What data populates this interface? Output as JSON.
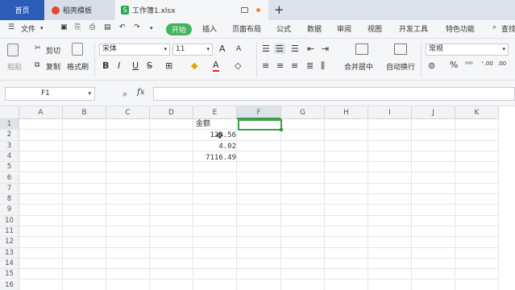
{
  "tabs": {
    "home": "首页",
    "template": "稻壳模板",
    "file": "工作簿1.xlsx"
  },
  "menu": {
    "file": "文件",
    "start": "开始",
    "insert": "插入",
    "layout": "页面布局",
    "formula": "公式",
    "data": "数据",
    "review": "审阅",
    "view": "视图",
    "dev": "开发工具",
    "special": "特色功能",
    "search": "查找"
  },
  "toolbar": {
    "paste": "粘贴",
    "cut": "剪切",
    "copy": "复制",
    "format_painter": "格式刷",
    "font": "宋体",
    "size": "11",
    "merge": "合并居中",
    "wrap": "自动换行",
    "numfmt": "常规",
    "bold": "B",
    "italic": "I",
    "underline": "U",
    "font_grow": "A",
    "font_shrink": "A",
    "font_color": "A",
    "percent": "%"
  },
  "formula_bar": {
    "cell_ref": "F1",
    "fx": "fx",
    "zoom_icon": "magnifier-icon"
  },
  "columns": [
    "A",
    "B",
    "C",
    "D",
    "E",
    "F",
    "G",
    "H",
    "I",
    "J",
    "K"
  ],
  "rows": [
    "1",
    "2",
    "3",
    "4",
    "5",
    "6",
    "7",
    "8",
    "9",
    "10",
    "11",
    "12",
    "13",
    "14",
    "15",
    "16"
  ],
  "cells": {
    "E1": "金额",
    "E2": "123.56",
    "E3": "4.02",
    "E4": "7116.49"
  },
  "selected_cell": "F1",
  "colors": {
    "accent": "#2b5cb8",
    "start": "#41b35b",
    "selection": "#3a9e4a"
  }
}
